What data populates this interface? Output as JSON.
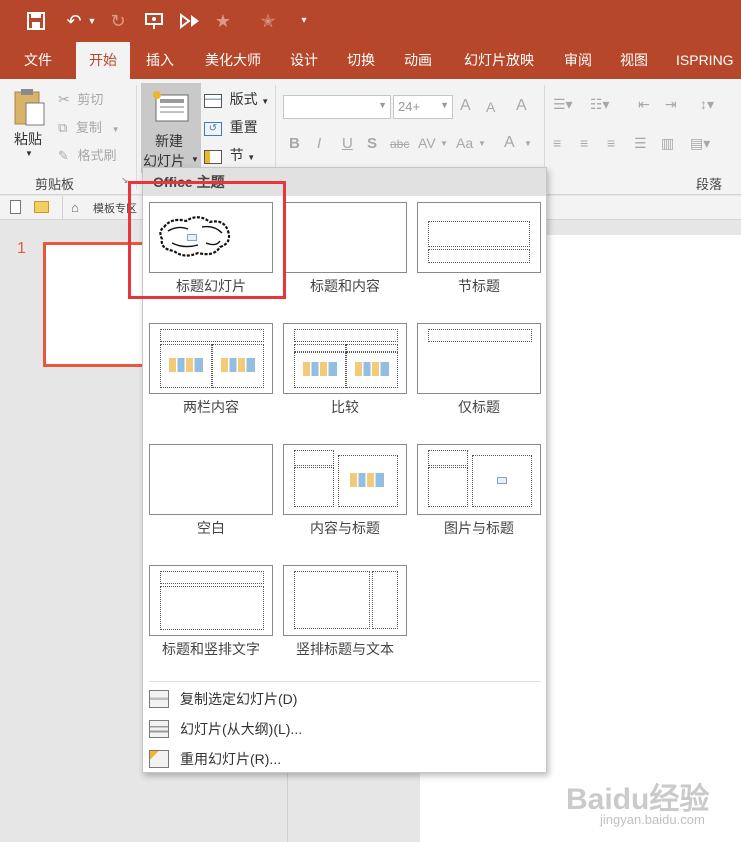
{
  "qat": {
    "icons": [
      "save-icon",
      "undo-icon",
      "undo-dropdown-icon",
      "redo-icon",
      "presentation-icon",
      "record-icon",
      "star-icon",
      "star-icon-2",
      "qat-customize-icon"
    ]
  },
  "tabs": [
    {
      "label": "文件",
      "active": false
    },
    {
      "label": "开始",
      "active": true
    },
    {
      "label": "插入",
      "active": false
    },
    {
      "label": "美化大师",
      "active": false
    },
    {
      "label": "设计",
      "active": false
    },
    {
      "label": "切换",
      "active": false
    },
    {
      "label": "动画",
      "active": false
    },
    {
      "label": "幻灯片放映",
      "active": false
    },
    {
      "label": "审阅",
      "active": false
    },
    {
      "label": "视图",
      "active": false
    },
    {
      "label": "ISPRING",
      "active": false
    }
  ],
  "ribbon": {
    "paste": "粘贴",
    "cut": "剪切",
    "copy": "复制",
    "format_painter": "格式刷",
    "clipboard_group": "剪贴板",
    "new_slide_line1": "新建",
    "new_slide_line2": "幻灯片",
    "layout": "版式",
    "reset": "重置",
    "section": "节",
    "font_size": "24+",
    "font_grow": "A",
    "font_shrink": "A",
    "clear_format": "A",
    "bold": "B",
    "italic": "I",
    "underline": "U",
    "shadow": "S",
    "strikethrough": "abc",
    "char_spacing": "AV",
    "change_case": "Aa",
    "font_color": "A",
    "paragraph_group": "段落"
  },
  "subbar": {
    "template_tab": "模板专区"
  },
  "thumbnails": {
    "slide_number": "1"
  },
  "dropdown": {
    "header": "Office 主题",
    "layouts": [
      {
        "label": "标题幻灯片"
      },
      {
        "label": "标题和内容"
      },
      {
        "label": "节标题"
      },
      {
        "label": "两栏内容"
      },
      {
        "label": "比较"
      },
      {
        "label": "仅标题"
      },
      {
        "label": "空白"
      },
      {
        "label": "内容与标题"
      },
      {
        "label": "图片与标题"
      },
      {
        "label": "标题和竖排文字"
      },
      {
        "label": "竖排标题与文本"
      }
    ],
    "menu": [
      {
        "label": "复制选定幻灯片(D)"
      },
      {
        "label": "幻灯片(从大纲)(L)..."
      },
      {
        "label": "重用幻灯片(R)..."
      }
    ]
  },
  "colors": {
    "accent": "#b7472a",
    "highlight_box": "#e8343a",
    "thumbnail_border": "#e8583f"
  },
  "watermark": {
    "brand": "Baidu经验",
    "url": "jingyan.baidu.com"
  }
}
